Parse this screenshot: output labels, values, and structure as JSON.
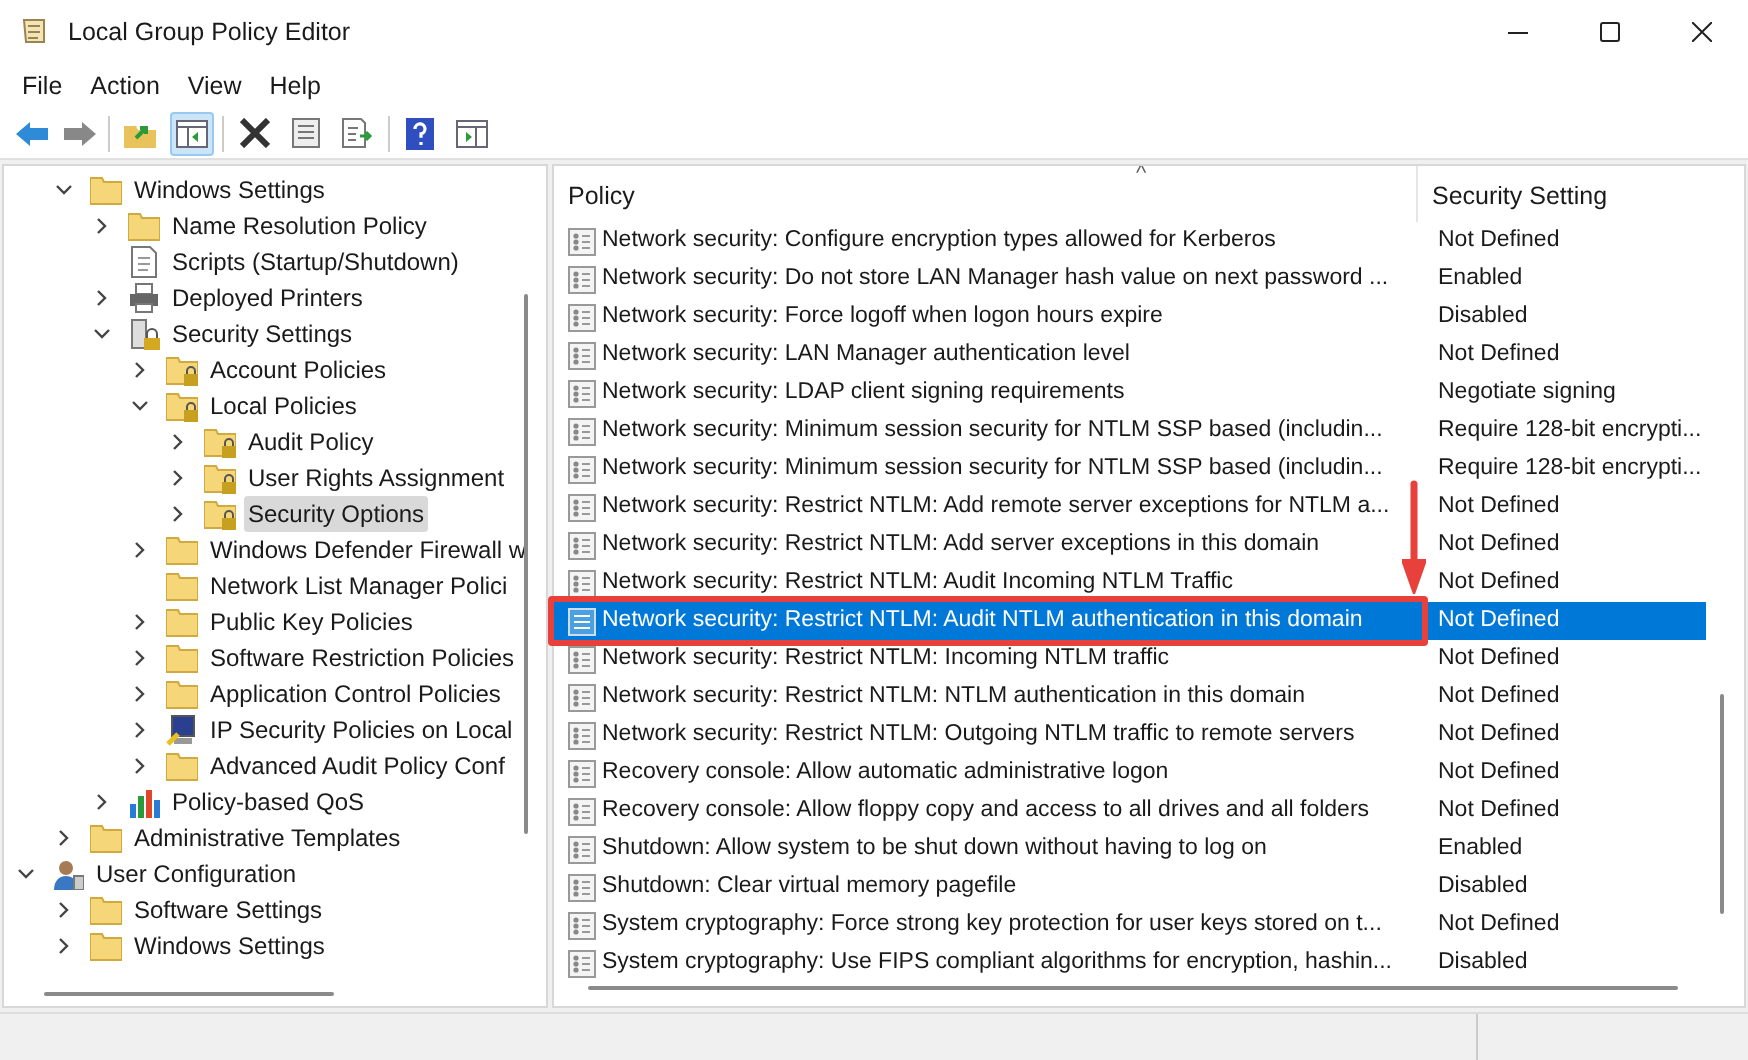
{
  "window": {
    "title": "Local Group Policy Editor"
  },
  "menu": [
    "File",
    "Action",
    "View",
    "Help"
  ],
  "tree": {
    "scrolled_branch": [
      {
        "label": "Windows Settings",
        "kind": "folder",
        "expanded": true,
        "selected": false,
        "children": [
          {
            "label": "Name Resolution Policy",
            "kind": "folder",
            "expanded": false,
            "selected": false
          },
          {
            "label": "Scripts (Startup/Shutdown)",
            "kind": "script",
            "selected": false
          },
          {
            "label": "Deployed Printers",
            "kind": "printer",
            "expanded": false,
            "selected": false
          },
          {
            "label": "Security Settings",
            "kind": "security",
            "expanded": true,
            "selected": false,
            "children": [
              {
                "label": "Account Policies",
                "kind": "lock-folder",
                "expanded": false,
                "selected": false
              },
              {
                "label": "Local Policies",
                "kind": "lock-folder",
                "expanded": true,
                "selected": false,
                "children": [
                  {
                    "label": "Audit Policy",
                    "kind": "lock-folder",
                    "expanded": false,
                    "selected": false
                  },
                  {
                    "label": "User Rights Assignment",
                    "kind": "lock-folder",
                    "expanded": false,
                    "selected": false
                  },
                  {
                    "label": "Security Options",
                    "kind": "lock-folder",
                    "expanded": false,
                    "selected": true
                  }
                ]
              },
              {
                "label": "Windows Defender Firewall w",
                "kind": "folder",
                "expanded": false,
                "selected": false
              },
              {
                "label": "Network List Manager Polici",
                "kind": "folder",
                "selected": false
              },
              {
                "label": "Public Key Policies",
                "kind": "folder",
                "expanded": false,
                "selected": false
              },
              {
                "label": "Software Restriction Policies",
                "kind": "folder",
                "expanded": false,
                "selected": false
              },
              {
                "label": "Application Control Policies",
                "kind": "folder",
                "expanded": false,
                "selected": false
              },
              {
                "label": "IP Security Policies on Local",
                "kind": "ip",
                "expanded": false,
                "selected": false
              },
              {
                "label": "Advanced Audit Policy Conf",
                "kind": "folder",
                "expanded": false,
                "selected": false
              }
            ]
          },
          {
            "label": "Policy-based QoS",
            "kind": "qos",
            "expanded": false,
            "selected": false
          }
        ]
      },
      {
        "label": "Administrative Templates",
        "kind": "folder",
        "expanded": false,
        "selected": false
      }
    ],
    "roots": [
      {
        "label": "User Configuration",
        "kind": "user",
        "expanded": true,
        "selected": false,
        "children": [
          {
            "label": "Software Settings",
            "kind": "folder",
            "expanded": false,
            "selected": false
          },
          {
            "label": "Windows Settings",
            "kind": "folder",
            "expanded": false,
            "selected": false
          }
        ]
      }
    ]
  },
  "table": {
    "columns": [
      "Policy",
      "Security Setting"
    ],
    "sort_indicator": "^",
    "rows": [
      {
        "policy": "Network security: Configure encryption types allowed for Kerberos",
        "setting": "Not Defined",
        "selected": false,
        "boxed": false
      },
      {
        "policy": "Network security: Do not store LAN Manager hash value on next password ...",
        "setting": "Enabled",
        "selected": false,
        "boxed": false
      },
      {
        "policy": "Network security: Force logoff when logon hours expire",
        "setting": "Disabled",
        "selected": false,
        "boxed": false
      },
      {
        "policy": "Network security: LAN Manager authentication level",
        "setting": "Not Defined",
        "selected": false,
        "boxed": false
      },
      {
        "policy": "Network security: LDAP client signing requirements",
        "setting": "Negotiate signing",
        "selected": false,
        "boxed": false
      },
      {
        "policy": "Network security: Minimum session security for NTLM SSP based (includin...",
        "setting": "Require 128-bit encrypti...",
        "selected": false,
        "boxed": false
      },
      {
        "policy": "Network security: Minimum session security for NTLM SSP based (includin...",
        "setting": "Require 128-bit encrypti...",
        "selected": false,
        "boxed": false
      },
      {
        "policy": "Network security: Restrict NTLM: Add remote server exceptions for NTLM a...",
        "setting": "Not Defined",
        "selected": false,
        "boxed": false
      },
      {
        "policy": "Network security: Restrict NTLM: Add server exceptions in this domain",
        "setting": "Not Defined",
        "selected": false,
        "boxed": false
      },
      {
        "policy": "Network security: Restrict NTLM: Audit Incoming NTLM Traffic",
        "setting": "Not Defined",
        "selected": false,
        "boxed": false
      },
      {
        "policy": "Network security: Restrict NTLM: Audit NTLM authentication in this domain",
        "setting": "Not Defined",
        "selected": true,
        "boxed": true
      },
      {
        "policy": "Network security: Restrict NTLM: Incoming NTLM traffic",
        "setting": "Not Defined",
        "selected": false,
        "boxed": false
      },
      {
        "policy": "Network security: Restrict NTLM: NTLM authentication in this domain",
        "setting": "Not Defined",
        "selected": false,
        "boxed": false
      },
      {
        "policy": "Network security: Restrict NTLM: Outgoing NTLM traffic to remote servers",
        "setting": "Not Defined",
        "selected": false,
        "boxed": false
      },
      {
        "policy": "Recovery console: Allow automatic administrative logon",
        "setting": "Not Defined",
        "selected": false,
        "boxed": false
      },
      {
        "policy": "Recovery console: Allow floppy copy and access to all drives and all folders",
        "setting": "Not Defined",
        "selected": false,
        "boxed": false
      },
      {
        "policy": "Shutdown: Allow system to be shut down without having to log on",
        "setting": "Enabled",
        "selected": false,
        "boxed": false
      },
      {
        "policy": "Shutdown: Clear virtual memory pagefile",
        "setting": "Disabled",
        "selected": false,
        "boxed": false
      },
      {
        "policy": "System cryptography: Force strong key protection for user keys stored on t...",
        "setting": "Not Defined",
        "selected": false,
        "boxed": false
      },
      {
        "policy": "System cryptography: Use FIPS compliant algorithms for encryption, hashin...",
        "setting": "Disabled",
        "selected": false,
        "boxed": false
      }
    ]
  },
  "annotation": {
    "color": "#e8413c"
  }
}
